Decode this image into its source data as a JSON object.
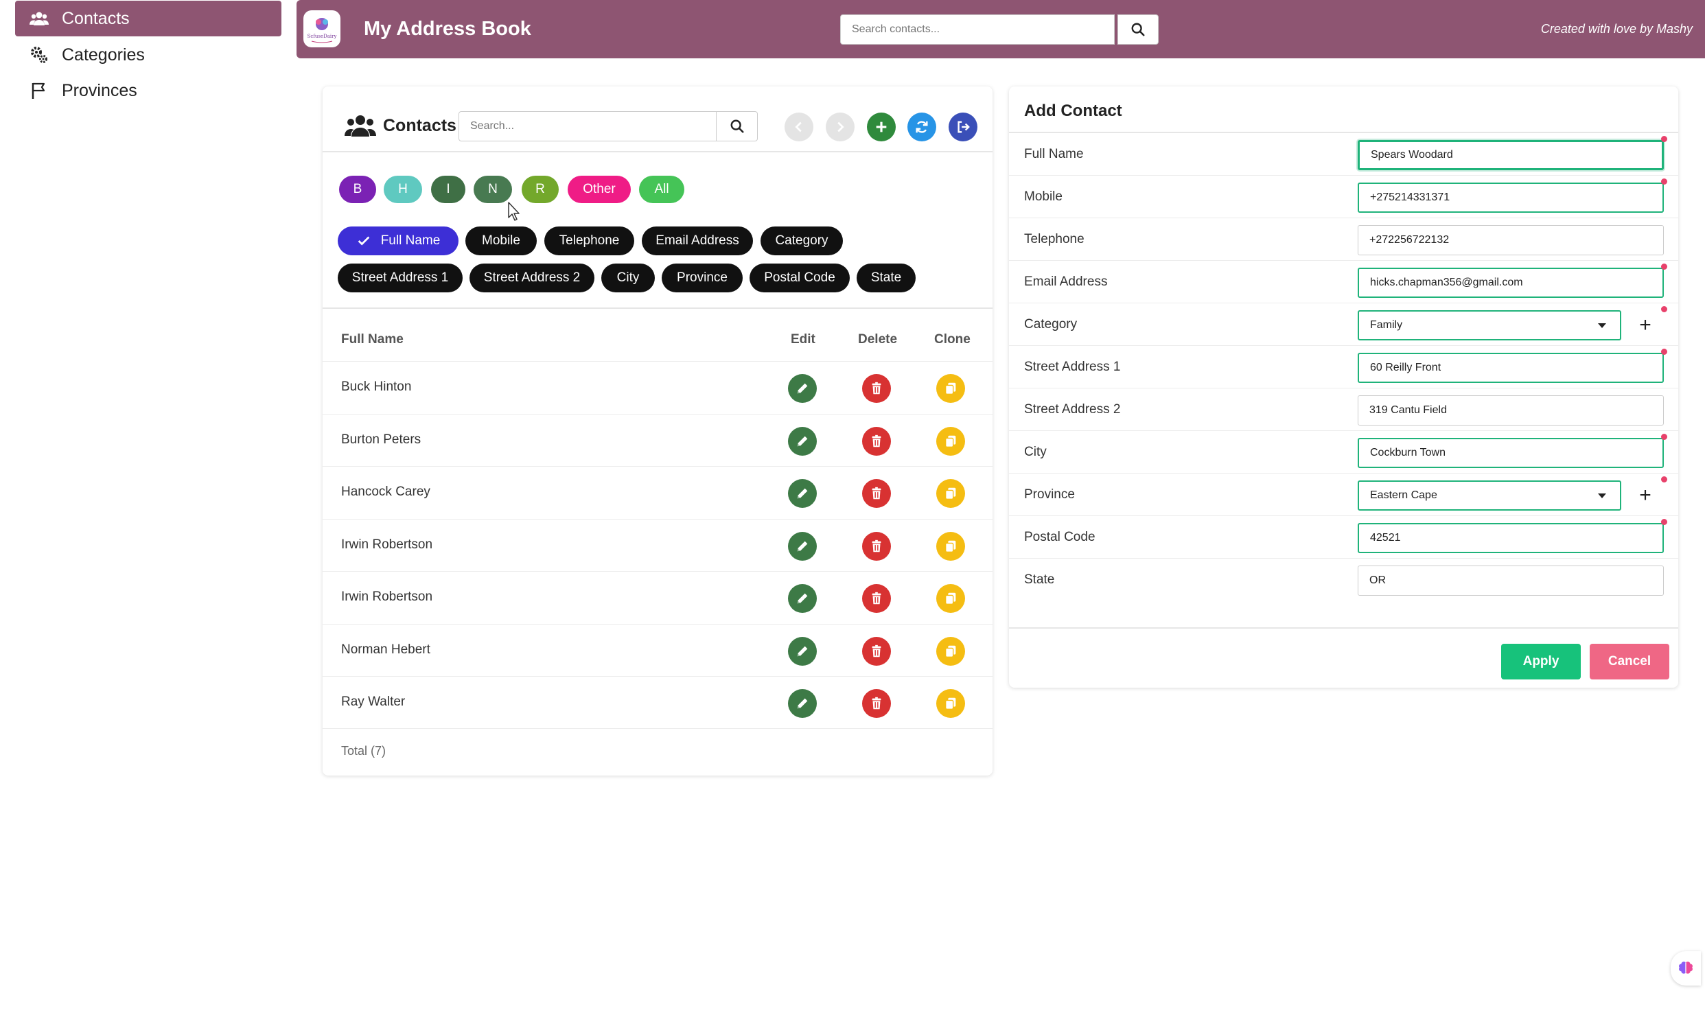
{
  "sidebar": {
    "items": [
      {
        "label": "Contacts",
        "icon": "users-icon",
        "active": true
      },
      {
        "label": "Categories",
        "icon": "gears-icon"
      },
      {
        "label": "Provinces",
        "icon": "flag-icon"
      }
    ]
  },
  "header": {
    "logo_text": "ScfuseDairy",
    "title": "My Address Book",
    "search_placeholder": "Search contacts...",
    "credit": "Created with love by Mashy",
    "bar_color": "#8e5572"
  },
  "contacts": {
    "title": "Contacts",
    "search_placeholder": "Search...",
    "letters": [
      {
        "label": "B",
        "color": "#7b22b4"
      },
      {
        "label": "H",
        "color": "#5fc9c0"
      },
      {
        "label": "I",
        "color": "#3f6f45"
      },
      {
        "label": "N",
        "color": "#487a51"
      },
      {
        "label": "R",
        "color": "#73a82b"
      },
      {
        "label": "Other",
        "color": "#ef1c86"
      },
      {
        "label": "All",
        "color": "#45c457"
      }
    ],
    "columns_row1": [
      "Full Name",
      "Mobile",
      "Telephone",
      "Email Address",
      "Category"
    ],
    "columns_row2": [
      "Street Address 1",
      "Street Address 2",
      "City",
      "Province",
      "Postal Code",
      "State"
    ],
    "table_headers": {
      "name": "Full Name",
      "edit": "Edit",
      "delete": "Delete",
      "clone": "Clone"
    },
    "rows": [
      "Buck Hinton",
      "Burton Peters",
      "Hancock Carey",
      "Irwin Robertson",
      "Irwin Robertson",
      "Norman Hebert",
      "Ray Walter"
    ],
    "total": "Total (7)"
  },
  "form": {
    "title": "Add Contact",
    "fields": [
      {
        "label": "Full Name",
        "value": "Spears Woodard"
      },
      {
        "label": "Mobile",
        "value": "+275214331371"
      },
      {
        "label": "Telephone",
        "value": "+272256722132"
      },
      {
        "label": "Email Address",
        "value": "hicks.chapman356@gmail.com"
      },
      {
        "label": "Category",
        "value": "Family"
      },
      {
        "label": "Street Address 1",
        "value": "60 Reilly Front"
      },
      {
        "label": "Street Address 2",
        "value": "319 Cantu Field"
      },
      {
        "label": "City",
        "value": "Cockburn Town"
      },
      {
        "label": "Province",
        "value": "Eastern Cape"
      },
      {
        "label": "Postal Code",
        "value": "42521"
      },
      {
        "label": "State",
        "value": "OR"
      }
    ],
    "apply": "Apply",
    "cancel": "Cancel"
  }
}
